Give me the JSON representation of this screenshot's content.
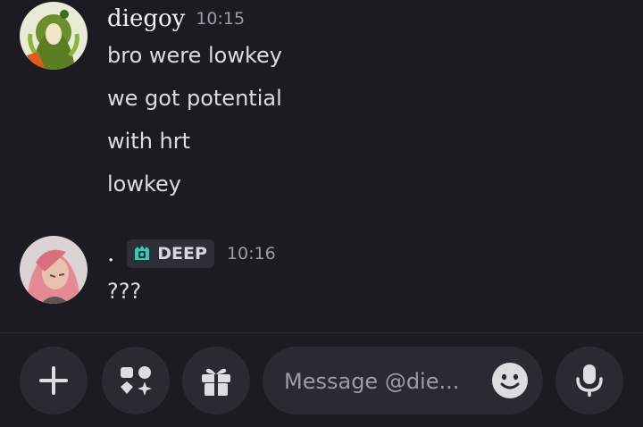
{
  "messages": [
    {
      "author": "diegoy",
      "time": "10:15",
      "lines": [
        "bro were lowkey",
        "we got potential",
        "with hrt",
        "lowkey"
      ]
    },
    {
      "author": ".",
      "tag": "DEEP",
      "time": "10:16",
      "lines": [
        "???"
      ]
    }
  ],
  "composer": {
    "placeholder": "Message @die...",
    "buttons": [
      "plus-icon",
      "apps-icon",
      "gift-icon",
      "emoji-icon",
      "microphone-icon"
    ]
  },
  "colors": {
    "background": "#1b1b21",
    "button_bg": "#2a2b32",
    "tag_icon": "#36c8b4"
  }
}
